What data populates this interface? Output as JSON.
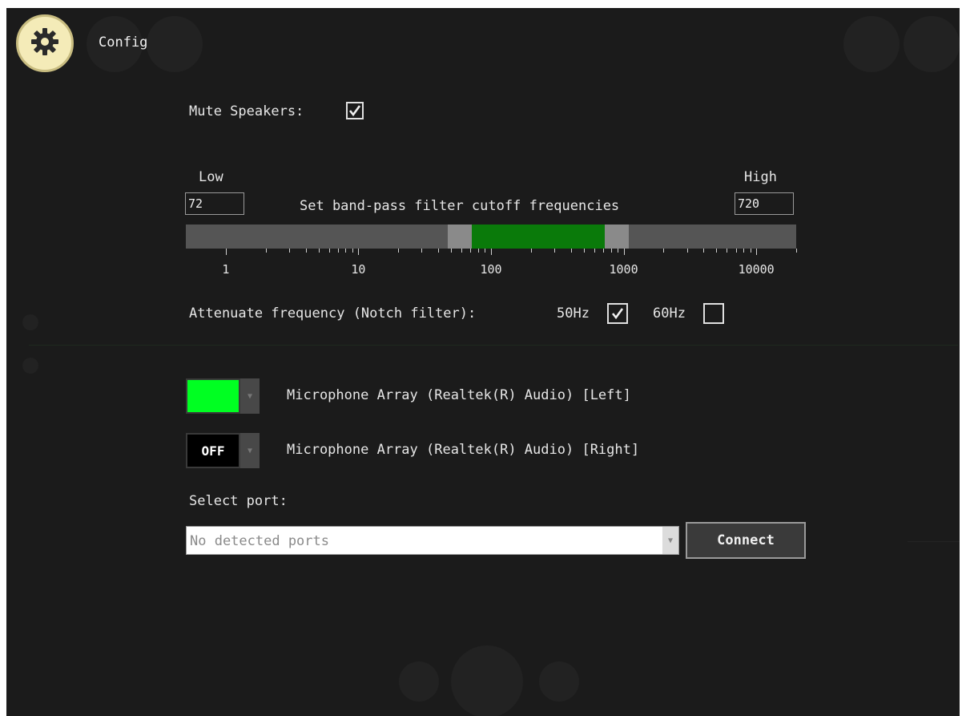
{
  "header": {
    "title": "Config",
    "icon": "gear-icon"
  },
  "mute": {
    "label": "Mute Speakers:",
    "checked": true
  },
  "bandpass": {
    "low_label": "Low",
    "high_label": "High",
    "low_value": "72",
    "high_value": "720",
    "caption": "Set band-pass filter cutoff frequencies",
    "scale_labels": [
      "1",
      "10",
      "100",
      "1000",
      "10000"
    ],
    "range_low_hz": 72,
    "range_high_hz": 720,
    "scale_min_hz": 0.5,
    "scale_max_hz": 20000
  },
  "notch": {
    "label": "Attenuate frequency (Notch filter):",
    "option_50": {
      "label": "50Hz",
      "checked": true
    },
    "option_60": {
      "label": "60Hz",
      "checked": false
    }
  },
  "channels": [
    {
      "color": "#00ff22",
      "swatch_text": "",
      "label": "Microphone Array (Realtek(R) Audio) [Left]"
    },
    {
      "color": "#000000",
      "swatch_text": "OFF",
      "label": "Microphone Array (Realtek(R) Audio) [Right]"
    }
  ],
  "port": {
    "label": "Select port:",
    "selected": "No detected ports",
    "connect_label": "Connect"
  },
  "colors": {
    "background": "#1b1b1b",
    "accent_green": "#0a7a0a",
    "header_button": "#f4ebb8"
  }
}
